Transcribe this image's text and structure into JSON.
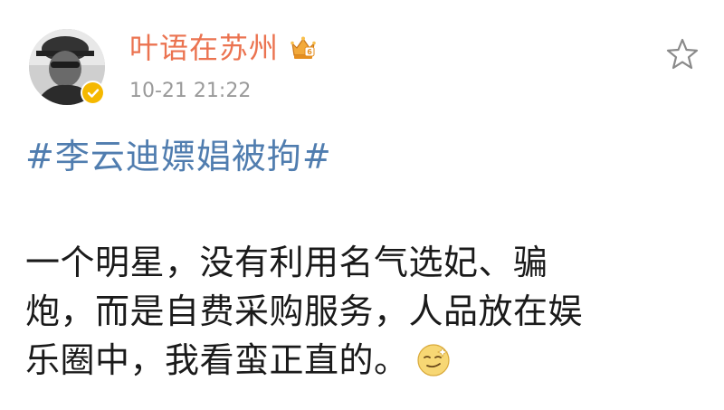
{
  "post": {
    "author": {
      "username": "叶语在苏州",
      "crown_badge_icon": "crown-badge-icon",
      "verified_icon": "verified-badge-icon"
    },
    "timestamp": "10-21 21:22",
    "favorite_icon": "star-outline-icon",
    "hashtag": "#李云迪嫖娼被拘#",
    "body_lines": [
      "一个明星，没有利用名气选妃、骗",
      "炮，而是自费采购服务，人品放在娱",
      "乐圈中，我看蛮正直的。"
    ],
    "emoji_icon": "smirk-emoji-icon"
  },
  "colors": {
    "username": "#eb7350",
    "hashtag": "#507daf",
    "timestamp": "#9a9a9a",
    "body_text": "#1a1a1a",
    "verified_badge": "#f5b800"
  }
}
